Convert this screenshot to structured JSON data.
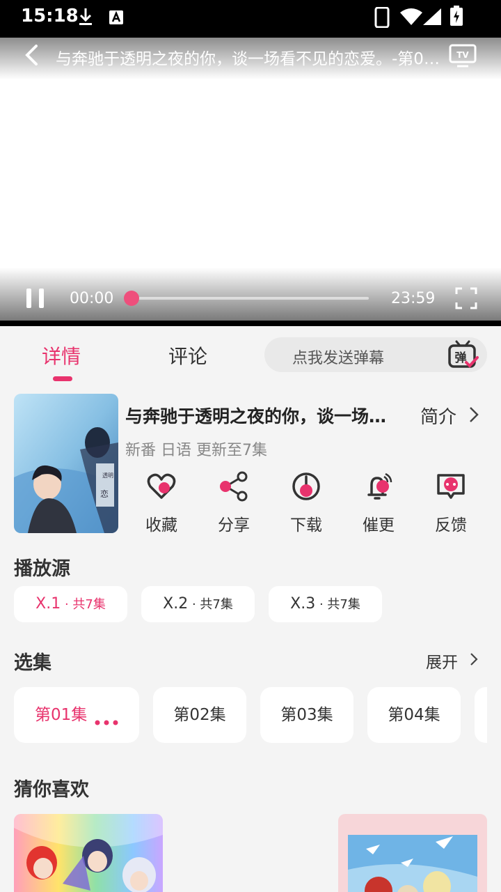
{
  "status_bar": {
    "time": "15:18"
  },
  "player": {
    "title": "与奔驰于透明之夜的你，谈一场看不见的恋爱。-第01集",
    "current_time": "00:00",
    "total_time": "23:59",
    "progress_fraction": 0.0
  },
  "tabs": {
    "details": "详情",
    "comments": "评论"
  },
  "danmaku": {
    "placeholder": "点我发送弹幕"
  },
  "show": {
    "title": "与奔驰于透明之夜的你，谈一场看不见的恋爱。",
    "intro_label": "简介",
    "meta": "新番 日语 更新至7集"
  },
  "actions": [
    {
      "label": "收藏",
      "icon": "heart-icon"
    },
    {
      "label": "分享",
      "icon": "share-icon"
    },
    {
      "label": "下载",
      "icon": "download-icon"
    },
    {
      "label": "催更",
      "icon": "bell-icon"
    },
    {
      "label": "反馈",
      "icon": "feedback-icon"
    }
  ],
  "sources": {
    "heading": "播放源",
    "items": [
      {
        "name": "X.1",
        "count": " · 共7集"
      },
      {
        "name": "X.2",
        "count": " · 共7集"
      },
      {
        "name": "X.3",
        "count": " · 共7集"
      }
    ],
    "selected_index": 0
  },
  "episodes": {
    "heading": "选集",
    "expand_label": "展开",
    "items": [
      "第01集",
      "第02集",
      "第03集",
      "第04集"
    ],
    "selected_index": 0
  },
  "recommend": {
    "heading": "猜你喜欢"
  },
  "colors": {
    "accent": "#e8336d",
    "background": "#f4f4f4"
  }
}
